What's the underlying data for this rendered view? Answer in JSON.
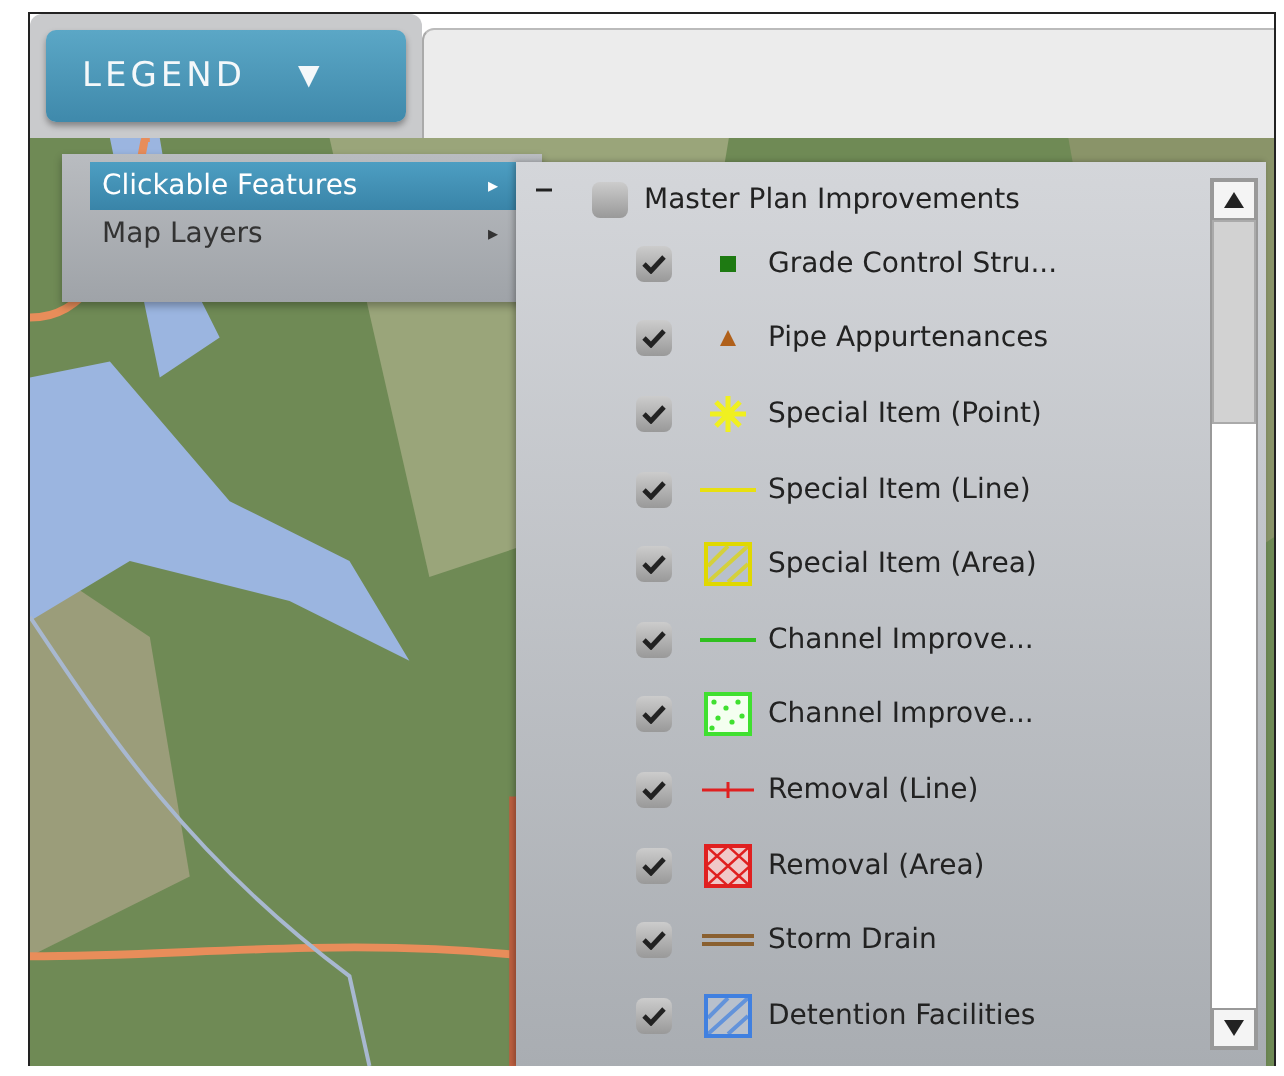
{
  "legend_button": {
    "label": "LEGEND",
    "caret": "▼"
  },
  "menu": {
    "items": [
      {
        "label": "Clickable Features",
        "selected": true,
        "arrow": "▸"
      },
      {
        "label": "Map Layers",
        "selected": false,
        "arrow": "▸"
      }
    ]
  },
  "legend": {
    "group": {
      "label": "Master Plan Improvements",
      "expanded": true,
      "checked": false
    },
    "items": [
      {
        "label": "Grade Control Stru...",
        "checked": true,
        "kind": "square",
        "color": "#1e7a12"
      },
      {
        "label": "Pipe Appurtenances",
        "checked": true,
        "kind": "triangle",
        "color": "#b0601a"
      },
      {
        "label": "Special Item (Point)",
        "checked": true,
        "kind": "star",
        "color": "#f0f020"
      },
      {
        "label": "Special Item (Line)",
        "checked": true,
        "kind": "line",
        "color": "#e8e010"
      },
      {
        "label": "Special Item (Area)",
        "checked": true,
        "kind": "hatch",
        "color": "#e0d800"
      },
      {
        "label": "Channel Improve...",
        "checked": true,
        "kind": "line",
        "color": "#30c020"
      },
      {
        "label": "Channel Improve...",
        "checked": true,
        "kind": "dots",
        "color": "#40e030"
      },
      {
        "label": "Removal (Line)",
        "checked": true,
        "kind": "tickline",
        "color": "#e02020"
      },
      {
        "label": "Removal (Area)",
        "checked": true,
        "kind": "crosshatch",
        "color": "#e02020"
      },
      {
        "label": "Storm Drain",
        "checked": true,
        "kind": "double",
        "color": "#8a6030"
      },
      {
        "label": "Detention Facilities",
        "checked": true,
        "kind": "hatch",
        "color": "#4080e0"
      }
    ]
  }
}
